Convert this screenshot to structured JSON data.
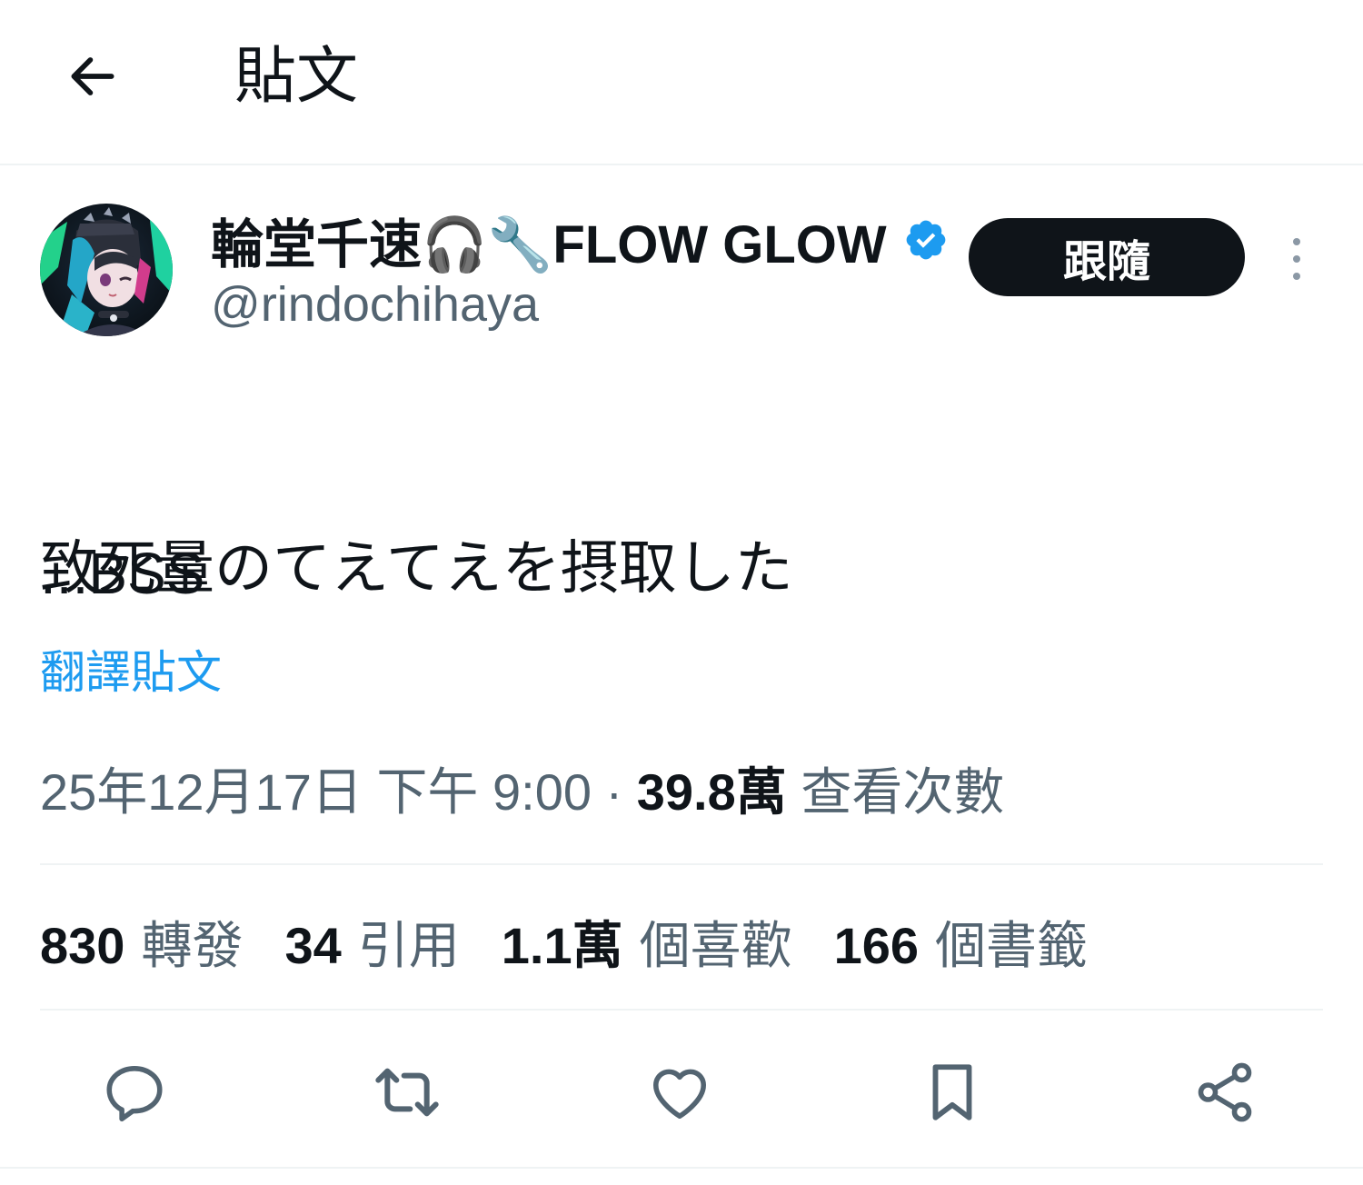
{
  "header": {
    "title": "貼文"
  },
  "author": {
    "display_name": "輪堂千速🎧🔧FLOW GLOW",
    "handle": "@rindochihaya",
    "verified": true,
    "follow_label": "跟隨"
  },
  "tweet": {
    "text_line1": "致死量のてえてえを摂取した",
    "text_line2": "...BSS",
    "translate_label": "翻譯貼文"
  },
  "meta": {
    "timestamp": "25年12月17日 下午 9:00",
    "separator": " · ",
    "views_count": "39.8萬",
    "views_label": "查看次數"
  },
  "stats": [
    {
      "count": "830",
      "label": "轉發"
    },
    {
      "count": "34",
      "label": "引用"
    },
    {
      "count": "1.1萬",
      "label": "個喜歡"
    },
    {
      "count": "166",
      "label": "個書籤"
    }
  ],
  "colors": {
    "accent": "#1d9bf0",
    "text_primary": "#0f1419",
    "text_secondary": "#536471",
    "border": "#eff3f4",
    "verified": "#1d9bf0"
  },
  "icons": [
    "back-arrow-icon",
    "verified-badge-icon",
    "more-vertical-icon",
    "reply-icon",
    "retweet-icon",
    "like-icon",
    "bookmark-icon",
    "share-icon"
  ]
}
